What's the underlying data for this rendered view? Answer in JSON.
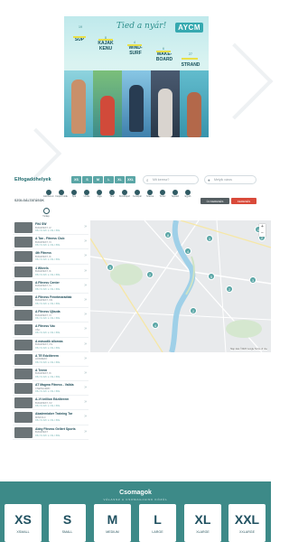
{
  "banner": {
    "title": "Tied a nyár!",
    "logo": "AYCM",
    "activities": [
      {
        "label": "SUP",
        "num": "19"
      },
      {
        "label": "KAJAK KENU",
        "num": "8"
      },
      {
        "label": "WIND-SURF",
        "num": "4"
      },
      {
        "label": "WAKE-BOARD",
        "num": "6"
      },
      {
        "label": "STRAND",
        "num": "27"
      }
    ]
  },
  "filter": {
    "title": "Elfogadóhelyek",
    "sizes": [
      "XS",
      "S",
      "M",
      "L",
      "XL",
      "XXL"
    ],
    "search_placeholder": "Mit keresz?",
    "city_placeholder": "Melyik város",
    "amenity_label": "SZOLGÁLTATÁSOK",
    "amenities": [
      "Edzőterem",
      "Csoport órák",
      "Spa",
      "Úszás",
      "Jóga",
      "Tánc",
      "Küzdősport",
      "Kerékpár",
      "Szauna",
      "Tenisz",
      "Squash",
      "Egyéb"
    ],
    "btn_reset": "ÚJ KERESÉS",
    "btn_search": "KERESÉS",
    "toggle_label": "Térkép"
  },
  "places": [
    {
      "name": "Fit4 SW",
      "address": "BUDAPEST, IV.",
      "sizes": "XS / S / M / L / XL / XXL"
    },
    {
      "name": "A Tan - Fitness Club",
      "address": "BUDAPEST, XI.",
      "sizes": "XS / S / M / L / XL / XXL"
    },
    {
      "name": "4th Fitness",
      "address": "BUDAPEST, III.",
      "sizes": "XS / S / M / L / XL / XXL"
    },
    {
      "name": "4 Wheels",
      "address": "BUDAPEST, III.",
      "sizes": "XS / S / M / L / XL / XXL"
    },
    {
      "name": "A Fitness Center",
      "address": "BUDAPEST, XI.",
      "sizes": "XS / S / M / L / XL / XXL"
    },
    {
      "name": "A Fitness Fenntmaradtak",
      "address": "BUDAPEST, XIII.",
      "sizes": "XS / S / M / L / XL / XXL"
    },
    {
      "name": "A Fitness Újbuda",
      "address": "BUDAPEST, XI.",
      "sizes": "XS / S / M / L / XL / XXL"
    },
    {
      "name": "A Fitness Vác",
      "address": "VÁC",
      "sizes": "XS / S / M / L / XL / XXL"
    },
    {
      "name": "A második állomás",
      "address": "BUDAPEST, XIV.",
      "sizes": "XS / S / M / L / XL / XXL"
    },
    {
      "name": "A TE Edzőterem",
      "address": "HÓDMEZŐ",
      "sizes": "XS / S / M / L / XL / XXL"
    },
    {
      "name": "A Terem",
      "address": "BUDAPEST, IX.",
      "sizes": "XS / S / M / L / XL / XXL"
    },
    {
      "name": "AT Magma Fitness - Vallda",
      "address": "CSEPEL/ÉRD",
      "sizes": "XS / S / M / L / XL / XXL"
    },
    {
      "name": "A-Vi brillion Edzőterem",
      "address": "BUDAPEST, XV.",
      "sizes": "XS / S / M / L / XL / XXL"
    },
    {
      "name": "Akademiaker Training Tar",
      "address": "MISKOLC",
      "sizes": "XS / S / M / L / XL / XXL"
    },
    {
      "name": "Abby Fitness Gellert Sports",
      "address": "BUDAPEST",
      "sizes": "XS / S / M / L / XL / XXL"
    }
  ],
  "map": {
    "credit": "Map data ©2020 Google  Terms of Use",
    "markers": [
      "8",
      "4",
      "3",
      "4",
      "2",
      "3",
      "2",
      "5",
      "2",
      "3",
      "2",
      "4"
    ]
  },
  "packages": {
    "title": "Csomagok",
    "subtitle": "VÁLASSZ A CSOMAGJAINK KÖZÜL",
    "items": [
      {
        "code": "XS",
        "name": "XSMALL"
      },
      {
        "code": "S",
        "name": "SMALL"
      },
      {
        "code": "M",
        "name": "MEDIUM"
      },
      {
        "code": "L",
        "name": "LARGE"
      },
      {
        "code": "XL",
        "name": "XLARGE"
      },
      {
        "code": "XXL",
        "name": "XXLARGE"
      }
    ]
  },
  "colors": {
    "accent": "#5aa6a6",
    "packages_bg": "#3d8a88",
    "dark_btn": "#555e62",
    "red_btn": "#d94a3a"
  }
}
